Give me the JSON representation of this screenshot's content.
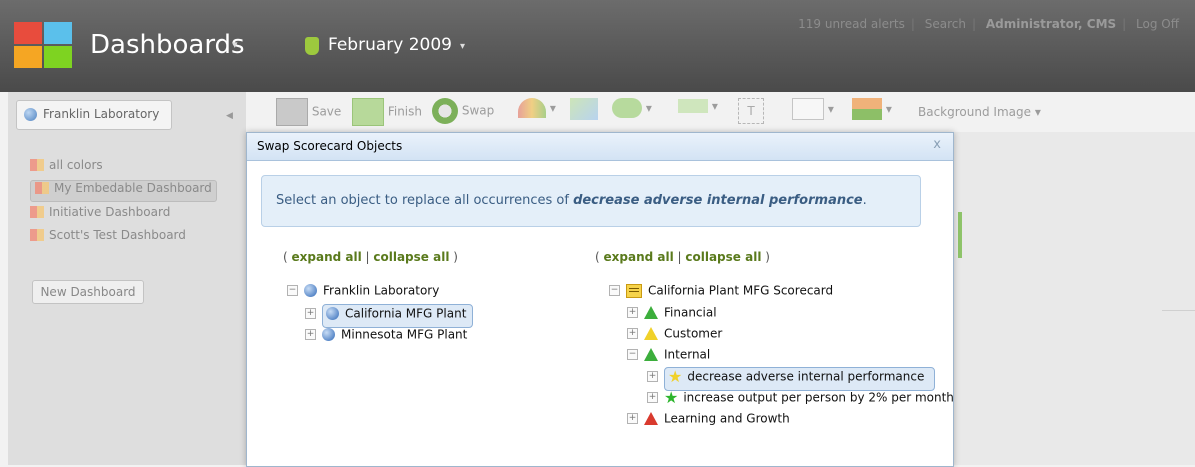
{
  "header": {
    "app_title": "Dashboards",
    "period": "February 2009",
    "links": {
      "alerts": "119 unread alerts",
      "search": "Search",
      "user": "Administrator, CMS",
      "logoff": "Log Off"
    },
    "sep": "|"
  },
  "sidebar": {
    "org": "Franklin Laboratory",
    "items": [
      {
        "label": "all colors"
      },
      {
        "label": "My Embedable Dashboard"
      },
      {
        "label": "Initiative Dashboard"
      },
      {
        "label": "Scott's Test Dashboard"
      }
    ],
    "new_button": "New Dashboard"
  },
  "toolbar": {
    "save": "Save",
    "finish": "Finish",
    "swap": "Swap",
    "background": "Background Image"
  },
  "modal": {
    "title": "Swap Scorecard Objects",
    "close": "x",
    "info_prefix": "Select an object to replace all occurrences of ",
    "info_object": "decrease adverse internal performance",
    "info_suffix": ".",
    "expand_all": "expand all",
    "collapse_all": "collapse all",
    "paren_open": "( ",
    "pipe": " | ",
    "paren_close": " )",
    "left_tree": {
      "root": "Franklin Laboratory",
      "children": [
        "California MFG Plant",
        "Minnesota MFG Plant"
      ]
    },
    "right_tree": {
      "root": "California Plant MFG Scorecard",
      "perspectives": [
        "Financial",
        "Customer",
        "Internal"
      ],
      "objectives": [
        "decrease adverse internal performance",
        "increase output per person by 2% per month"
      ],
      "last": "Learning and Growth"
    }
  },
  "colors": {
    "accent_green": "#5a7a1c",
    "info_bg": "#e4eff9",
    "selected_bg": "#dde9f6"
  }
}
